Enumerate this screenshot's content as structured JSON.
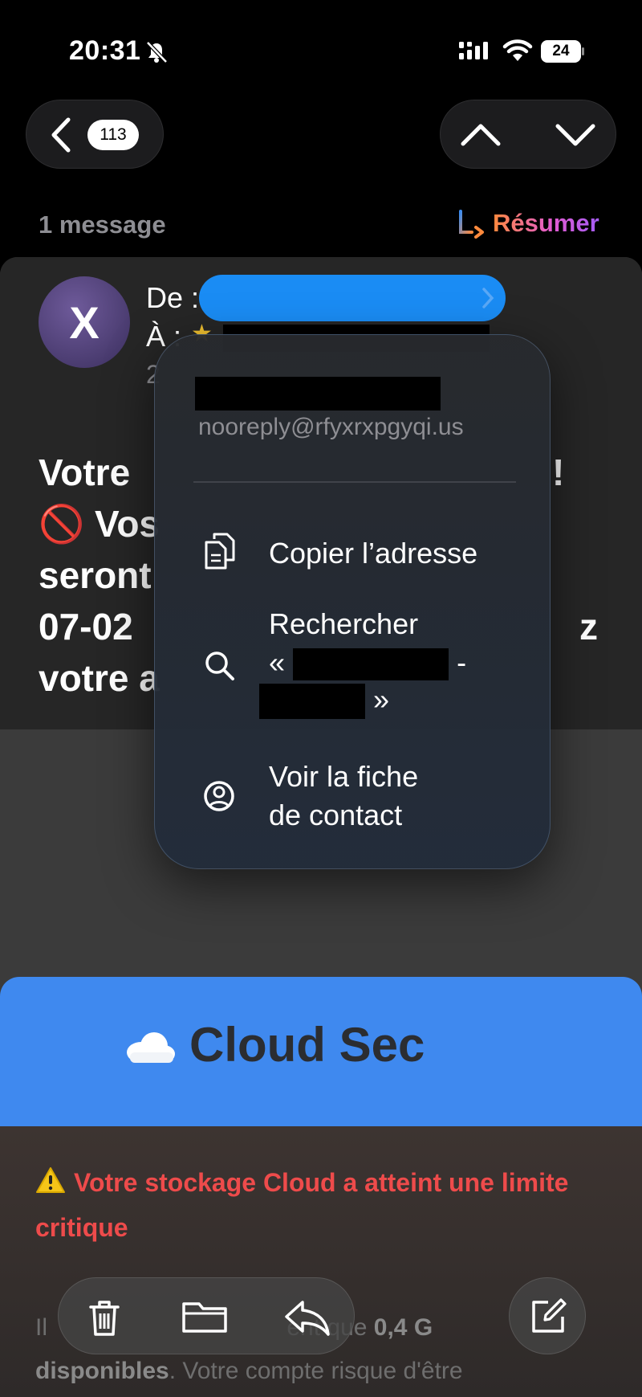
{
  "status_bar": {
    "time": "20:31",
    "battery": "24"
  },
  "nav": {
    "unread_count": "113"
  },
  "thread": {
    "message_count": "1 message",
    "summarize_label": "Résumer"
  },
  "email": {
    "avatar_initial": "X",
    "from_label": "De :",
    "to_label": "À :",
    "date_fragment": "2",
    "subject_lines": [
      "Votre",
      "!",
      "🚫 Vos",
      "seront",
      "07-02",
      "z",
      "votre a"
    ]
  },
  "popover": {
    "email": "nooreply@rfyxrxpgyqi.us",
    "items": {
      "copy": "Copier l’adresse",
      "search_line1": "Rechercher",
      "search_open": "«",
      "search_dash": "-",
      "search_close": "»",
      "contact_line1": "Voir la fiche",
      "contact_line2": "de contact"
    }
  },
  "body": {
    "banner_title": "Cloud Sec",
    "warning": "Votre stockage Cloud a atteint une limite critique",
    "text_start": "Il",
    "text_mid": "ent que",
    "text_bold1": "0,4 G",
    "text_bold2": "disponibles",
    "text_end": ". Votre compte risque d'être"
  },
  "colors": {
    "accent": "#1a8cf4",
    "banner": "#3f89ef",
    "warning": "#ee4b4b"
  },
  "icons": [
    "bell-slash-icon",
    "signal-icon",
    "wifi-icon",
    "battery-icon",
    "chevron-left-icon",
    "chevron-up-icon",
    "chevron-down-icon",
    "summarize-icon",
    "copy-icon",
    "search-icon",
    "person-circle-icon",
    "trash-icon",
    "folder-icon",
    "reply-icon",
    "compose-icon",
    "cloud-icon",
    "warning-icon"
  ]
}
